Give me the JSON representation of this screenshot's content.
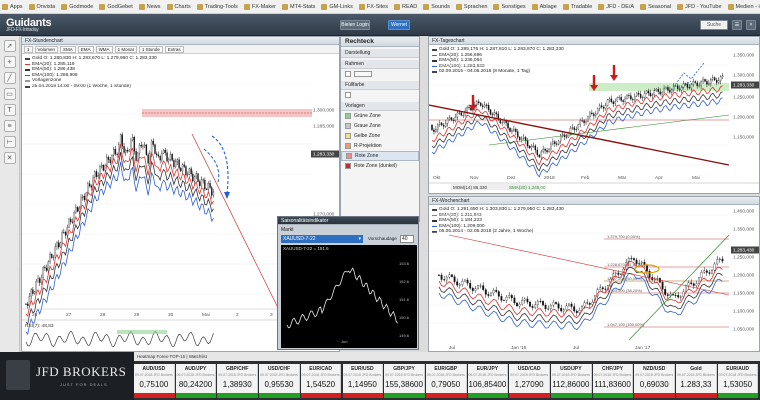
{
  "bookmarks": [
    "Apps",
    "Onvista",
    "Godmode",
    "GodGebet",
    "News",
    "Charts",
    "Trading-Tools",
    "FX-Maker",
    "MT4-Stats",
    "GM-Links",
    "FX-Sites",
    "READ",
    "Sounds",
    "Sprachen",
    "Sonstiges",
    "Ablage",
    "Tradable",
    "JFD - DE/A",
    "Seasonal",
    "JFD - YouTube",
    "Medien - investor"
  ],
  "app": {
    "logo": "Guidants",
    "logo_sub": "JFD-FX-Intraday",
    "header_left_button": "Bielen Login",
    "header_right_button": "Wernet",
    "search": "Suche"
  },
  "left_toolbar_icons": [
    "cursor-icon",
    "crosshair-icon",
    "line-icon",
    "rect-icon",
    "text-icon",
    "fib-icon",
    "ruler-icon",
    "trash-icon"
  ],
  "chart1": {
    "title": "FX-Stundenchart",
    "toolbar": [
      "1",
      "Volumen",
      "SMA",
      "EMA",
      "WMA",
      "1 Monat",
      "1 Stunde",
      "Extras"
    ],
    "legend": [
      {
        "text": "Gold O: 1.280,830 H: 1.283,670 L: 1.279,960 C: 1.283,330",
        "color": "#444444"
      },
      {
        "text": "EMA(20): 1.285,119",
        "color": "#e03030"
      },
      {
        "text": "EMA(50): 1.286,438",
        "color": "#333333"
      },
      {
        "text": "EMA(100): 1.286,908",
        "color": "#3060d0"
      },
      {
        "text": "Vorlagenzone",
        "color": "#999999"
      },
      {
        "text": "25.04.2018 14:00 - 09:00 (1 Woche, 1 Stunde)",
        "color": "#444444"
      }
    ],
    "price_labels": [
      "1.300,000",
      "1.285,000",
      "1.283,330",
      "1.270,000"
    ],
    "x_labels": [
      "26",
      "27",
      "28",
      "29",
      "30",
      "Mai",
      "2",
      "3"
    ],
    "indicator": "RSI(7): 48,83"
  },
  "tools": {
    "title": "Rechteck",
    "sections": [
      "Darstellung",
      "Rahmen",
      "Füllfarbe",
      "Vorlagen"
    ],
    "items": [
      "Grüne Zone",
      "Graue Zone",
      "Gelbe Zone",
      "R-Projektion",
      "Rote Zone",
      "Rote Zone (dunkel)"
    ]
  },
  "seasonal": {
    "title": "Saisonalitätsindikator",
    "menu": "Markt",
    "select_value": "XAUUSD-7-22",
    "lookback_label": "Vorschaudage",
    "lookback_value": "40",
    "series_label": "XAUUSD-7-22 = 151.6",
    "y_labels": [
      "153.6",
      "152.6",
      "151.6",
      "150.6",
      "149.6"
    ],
    "x_label": "Jun"
  },
  "chart2": {
    "title": "FX-Tageschart",
    "legend": [
      {
        "text": "Gold O: 1.285,176 H: 1.287,810 L: 1.283,870 C: 1.283,330",
        "color": "#444444"
      },
      {
        "text": "EMA(20): 1.256,696",
        "color": "#e03030"
      },
      {
        "text": "EMA(50): 1.236,064",
        "color": "#333333"
      },
      {
        "text": "EMA(100): 1.283,933",
        "color": "#3060d0"
      },
      {
        "text": "02.09.2015 - 04.05.2018 (8 Monate, 1 Tag)",
        "color": "#444444"
      }
    ],
    "price_labels": [
      "1.350,000",
      "1.300,000",
      "1.283,330",
      "1.250,000",
      "1.200,000",
      "1.150,000"
    ],
    "x_labels": [
      "Okt",
      "Nov",
      "Dez",
      "2018",
      "Feb",
      "Mär",
      "Apr",
      "Mai"
    ],
    "indicator": "MOM(14) 86,330",
    "indicator2": "SMA(20) 1.245,00"
  },
  "chart3": {
    "title": "FX-Wochenchart",
    "legend": [
      {
        "text": "Gold O: 1.291,690 H: 1.303,830 L: 1.279,950 C: 1.283,430",
        "color": "#444444"
      },
      {
        "text": "EMA(20): 1.211,843",
        "color": "#e03030"
      },
      {
        "text": "EMA(50): 1.184,223",
        "color": "#333333"
      },
      {
        "text": "EMA(100): 1.209,000",
        "color": "#3060d0"
      },
      {
        "text": "05.05.2014 - 02.05.2018 (2 Jahre, 1 Woche)",
        "color": "#444444"
      }
    ],
    "price_labels": [
      "1.400,000",
      "1.350,000",
      "1.283,430",
      "1.250,000",
      "1.200,000",
      "1.150,000",
      "1.100,000",
      "1.050,000"
    ],
    "fib_labels": [
      "1.379,700 (0,00%)",
      "1.228,870 (61,80%)",
      "1.197,200 (50,00%)",
      "1.153,500 (38,20%)",
      "1.047,100 (100,00%)"
    ],
    "x_labels": [
      "Jul",
      "Jan '16",
      "Jul",
      "Jan '17"
    ]
  },
  "ticker": {
    "title": "Heatmap Forex-TOP-15 | Watchlist",
    "ad_brand": "JFD BROKERS",
    "ad_tagline": "JUST FOR DEALS",
    "tiles": [
      {
        "symbol": "AUD/USD",
        "sub": "09.07.2018 JFD Brokers",
        "value": "0,75100",
        "trend": "#d62020"
      },
      {
        "symbol": "AUD/JPY",
        "sub": "09.07.2018 JFD Brokers",
        "value": "80,24200",
        "trend": "#22a022"
      },
      {
        "symbol": "GBP/CHF",
        "sub": "09.07.2018 JFD Brokers",
        "value": "1,38930",
        "trend": "#22a022"
      },
      {
        "symbol": "USD/CHF",
        "sub": "09.07.2018 JFD Brokers",
        "value": "0,95530",
        "trend": "#22a022"
      },
      {
        "symbol": "EUR/CAD",
        "sub": "09.07.2018 JFD Brokers",
        "value": "1,54520",
        "trend": "#d62020"
      },
      {
        "symbol": "EUR/USD",
        "sub": "09.07.2018 JFD Brokers",
        "value": "1,14950",
        "trend": "#d62020"
      },
      {
        "symbol": "GBP/JPY",
        "sub": "09.07.2018 JFD Brokers",
        "value": "155,38600",
        "trend": "#22a022"
      },
      {
        "symbol": "EUR/GBP",
        "sub": "09.07.2018 JFD Brokers",
        "value": "0,79050",
        "trend": "#d62020"
      },
      {
        "symbol": "EUR/JPY",
        "sub": "09.07.2018 JFD Brokers",
        "value": "106,85400",
        "trend": "#22a022"
      },
      {
        "symbol": "USD/CAD",
        "sub": "09.07.2018 JFD Brokers",
        "value": "1,27090",
        "trend": "#d62020"
      },
      {
        "symbol": "USD/JPY",
        "sub": "09.07.2018 JFD Brokers",
        "value": "112,86000",
        "trend": "#22a022"
      },
      {
        "symbol": "CHF/JPY",
        "sub": "09.07.2018 JFD Brokers",
        "value": "111,83600",
        "trend": "#22a022"
      },
      {
        "symbol": "NZD/USD",
        "sub": "09.07.2018 JFD Brokers",
        "value": "0,69030",
        "trend": "#d62020"
      },
      {
        "symbol": "Gold",
        "sub": "09.07.2018 JFD Brokers",
        "value": "1.283,33",
        "trend": "#d62020"
      },
      {
        "symbol": "EUR/AUD",
        "sub": "09.07.2018 JFD Brokers",
        "value": "1,53050",
        "trend": "#22a022"
      }
    ]
  },
  "colors": {
    "ema20": "#e03030",
    "ema50": "#333333",
    "ema100": "#3060d0",
    "candle_up": "#1a1a1a",
    "arrow_red": "#d01818",
    "arrow_blue": "#1f5fd6",
    "zone_red": "#f4b8b8",
    "zone_green": "#bfe8b8"
  }
}
